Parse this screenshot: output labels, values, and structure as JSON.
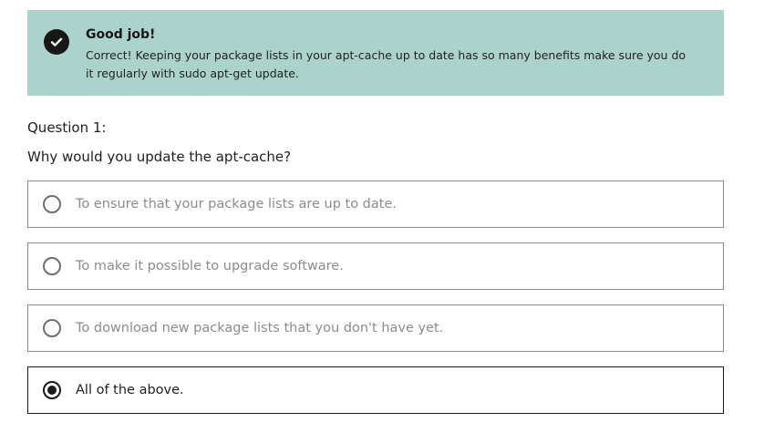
{
  "feedback": {
    "icon": "checkmark-circle-icon",
    "title": "Good job!",
    "message": "Correct! Keeping your package lists in your apt-cache up to date has so many benefits make sure you do it regularly with sudo apt-get update.",
    "background_color": "#acd3cb"
  },
  "question": {
    "number_label": "Question 1:",
    "text": "Why would you update the apt-cache?",
    "options": [
      {
        "label": "To ensure that your package lists are up to date.",
        "selected": false
      },
      {
        "label": "To make it possible to upgrade software.",
        "selected": false
      },
      {
        "label": "To download new package lists that you don't have yet.",
        "selected": false
      },
      {
        "label": "All of the above.",
        "selected": true
      }
    ]
  }
}
